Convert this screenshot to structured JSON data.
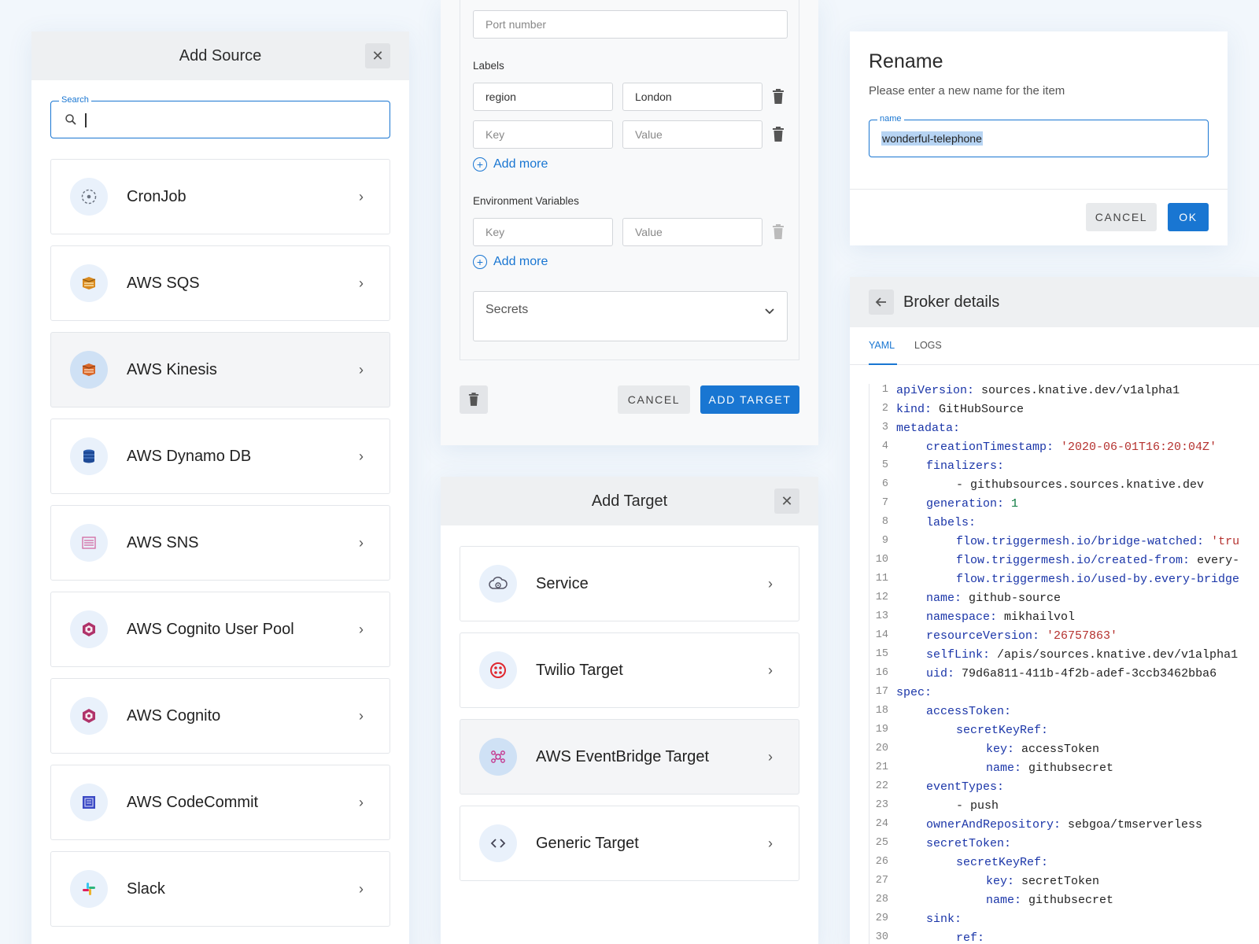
{
  "add_source": {
    "title": "Add Source",
    "search_label": "Search",
    "search_value": "",
    "items": [
      {
        "label": "CronJob",
        "icon": "cronjob-icon"
      },
      {
        "label": "AWS SQS",
        "icon": "aws-sqs-icon"
      },
      {
        "label": "AWS Kinesis",
        "icon": "aws-kinesis-icon"
      },
      {
        "label": "AWS Dynamo DB",
        "icon": "aws-dynamodb-icon"
      },
      {
        "label": "AWS SNS",
        "icon": "aws-sns-icon"
      },
      {
        "label": "AWS Cognito User Pool",
        "icon": "aws-cognito-icon"
      },
      {
        "label": "AWS Cognito",
        "icon": "aws-cognito-icon"
      },
      {
        "label": "AWS CodeCommit",
        "icon": "aws-codecommit-icon"
      },
      {
        "label": "Slack",
        "icon": "slack-icon"
      }
    ]
  },
  "target_form": {
    "port_placeholder": "Port number",
    "labels_heading": "Labels",
    "label_rows": [
      {
        "key": "region",
        "value": "London"
      },
      {
        "key_placeholder": "Key",
        "value_placeholder": "Value"
      }
    ],
    "add_more": "Add more",
    "env_heading": "Environment Variables",
    "env_key_placeholder": "Key",
    "env_value_placeholder": "Value",
    "secrets_label": "Secrets",
    "cancel": "CANCEL",
    "add_target": "ADD TARGET"
  },
  "add_target": {
    "title": "Add Target",
    "items": [
      {
        "label": "Service",
        "icon": "service-cloud-gear-icon"
      },
      {
        "label": "Twilio Target",
        "icon": "twilio-icon"
      },
      {
        "label": "AWS EventBridge Target",
        "icon": "aws-eventbridge-icon"
      },
      {
        "label": "Generic Target",
        "icon": "code-brackets-icon"
      }
    ]
  },
  "rename": {
    "title": "Rename",
    "subtitle": "Please enter a new name for the item",
    "field_label": "name",
    "field_value": "wonderful-telephone",
    "cancel": "CANCEL",
    "ok": "OK"
  },
  "broker": {
    "title": "Broker details",
    "tabs": [
      "YAML",
      "LOGS"
    ],
    "active_tab": "YAML",
    "yaml_lines": [
      {
        "n": "1",
        "indent": 0,
        "key": "apiVersion:",
        "val": " sources.knative.dev/v1alpha1",
        "t": "p"
      },
      {
        "n": "2",
        "indent": 0,
        "key": "kind:",
        "val": " GitHubSource",
        "t": "p"
      },
      {
        "n": "3",
        "indent": 0,
        "key": "metadata:",
        "val": "",
        "t": "p"
      },
      {
        "n": "4",
        "indent": 1,
        "key": "creationTimestamp:",
        "val": " '2020-06-01T16:20:04Z'",
        "t": "s"
      },
      {
        "n": "5",
        "indent": 1,
        "key": "finalizers:",
        "val": "",
        "t": "p"
      },
      {
        "n": "6",
        "indent": 2,
        "key": "",
        "val": "- githubsources.sources.knative.dev",
        "t": "p"
      },
      {
        "n": "7",
        "indent": 1,
        "key": "generation:",
        "val": " 1",
        "t": "n"
      },
      {
        "n": "8",
        "indent": 1,
        "key": "labels:",
        "val": "",
        "t": "p"
      },
      {
        "n": "9",
        "indent": 2,
        "key": "flow.triggermesh.io/bridge-watched:",
        "val": " 'tru",
        "t": "s"
      },
      {
        "n": "10",
        "indent": 2,
        "key": "flow.triggermesh.io/created-from:",
        "val": " every-",
        "t": "p"
      },
      {
        "n": "11",
        "indent": 2,
        "key": "flow.triggermesh.io/used-by.every-bridge",
        "val": "",
        "t": "p"
      },
      {
        "n": "12",
        "indent": 1,
        "key": "name:",
        "val": " github-source",
        "t": "p"
      },
      {
        "n": "13",
        "indent": 1,
        "key": "namespace:",
        "val": " mikhailvol",
        "t": "p"
      },
      {
        "n": "14",
        "indent": 1,
        "key": "resourceVersion:",
        "val": " '26757863'",
        "t": "s"
      },
      {
        "n": "15",
        "indent": 1,
        "key": "selfLink:",
        "val": " /apis/sources.knative.dev/v1alpha1",
        "t": "p"
      },
      {
        "n": "16",
        "indent": 1,
        "key": "uid:",
        "val": " 79d6a811-411b-4f2b-adef-3ccb3462bba6",
        "t": "p"
      },
      {
        "n": "17",
        "indent": 0,
        "key": "spec:",
        "val": "",
        "t": "p"
      },
      {
        "n": "18",
        "indent": 1,
        "key": "accessToken:",
        "val": "",
        "t": "p"
      },
      {
        "n": "19",
        "indent": 2,
        "key": "secretKeyRef:",
        "val": "",
        "t": "p"
      },
      {
        "n": "20",
        "indent": 3,
        "key": "key:",
        "val": " accessToken",
        "t": "p"
      },
      {
        "n": "21",
        "indent": 3,
        "key": "name:",
        "val": " githubsecret",
        "t": "p"
      },
      {
        "n": "22",
        "indent": 1,
        "key": "eventTypes:",
        "val": "",
        "t": "p"
      },
      {
        "n": "23",
        "indent": 2,
        "key": "",
        "val": "- push",
        "t": "p"
      },
      {
        "n": "24",
        "indent": 1,
        "key": "ownerAndRepository:",
        "val": " sebgoa/tmserverless",
        "t": "p"
      },
      {
        "n": "25",
        "indent": 1,
        "key": "secretToken:",
        "val": "",
        "t": "p"
      },
      {
        "n": "26",
        "indent": 2,
        "key": "secretKeyRef:",
        "val": "",
        "t": "p"
      },
      {
        "n": "27",
        "indent": 3,
        "key": "key:",
        "val": " secretToken",
        "t": "p"
      },
      {
        "n": "28",
        "indent": 3,
        "key": "name:",
        "val": " githubsecret",
        "t": "p"
      },
      {
        "n": "29",
        "indent": 1,
        "key": "sink:",
        "val": "",
        "t": "p"
      },
      {
        "n": "30",
        "indent": 2,
        "key": "ref:",
        "val": "",
        "t": "p"
      }
    ]
  },
  "colors": {
    "accent": "#1976d2",
    "background": "#f2f7fc",
    "header": "#eef0f2"
  }
}
